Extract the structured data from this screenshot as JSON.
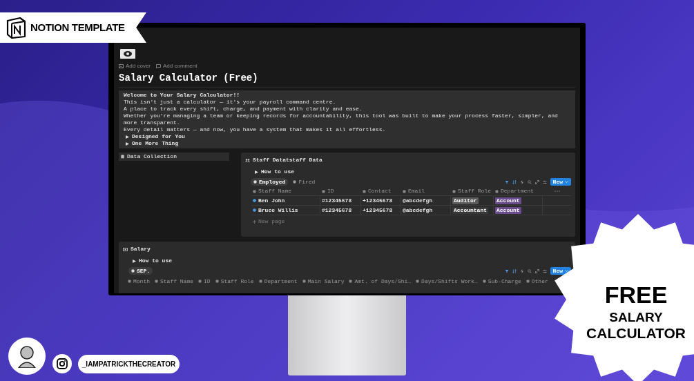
{
  "badge": {
    "label": "NOTION TEMPLATE"
  },
  "page": {
    "links": [
      "Add cover",
      "Add comment"
    ],
    "title": "Salary Calculator (Free)",
    "callout": {
      "lines": [
        "Welcome to Your Salary Calculator!!",
        "This isn't just a calculator — it's your payroll command centre.",
        "A place to track every shift, charge, and payment with clarity and ease.",
        "Whether you're managing a team or keeping records for accountability, this tool was built to make your process faster, simpler, and more transparent.",
        "Every detail matters — and now, you have a system that makes it all effortless."
      ],
      "toggles": [
        "Designed for You",
        "One More Thing"
      ]
    }
  },
  "sidebar": {
    "items": [
      {
        "label": "Data Collection",
        "selected": true
      }
    ]
  },
  "staff_db": {
    "title": "Staff Datatstaff Data",
    "toggle": "How to use",
    "views": [
      {
        "label": "Employed",
        "selected": true
      },
      {
        "label": "Fired",
        "selected": false
      }
    ],
    "new_button": "New",
    "columns": [
      "Staff Name",
      "ID",
      "Contact",
      "Email",
      "Staff Role",
      "Department"
    ],
    "rows": [
      {
        "name": "Ben John",
        "id": "#12345678",
        "contact": "+12345678",
        "email": "@abcdefgh",
        "role": {
          "label": "Auditor",
          "color": "#5a5a5a"
        },
        "department": {
          "label": "Account",
          "color": "#6a4c8c"
        }
      },
      {
        "name": "Bruce Willis",
        "id": "#12345678",
        "contact": "+12345678",
        "email": "@abcdefgh",
        "role": {
          "label": "Accountant",
          "color": "#383838"
        },
        "department": {
          "label": "Account",
          "color": "#6a4c8c"
        }
      }
    ],
    "add_row": "New page"
  },
  "salary_db": {
    "title": "Salary",
    "toggle": "How to use",
    "views": [
      {
        "label": "SEP.",
        "selected": true
      }
    ],
    "new_button": "New",
    "columns": [
      "Month",
      "Staff Name",
      "ID",
      "Staff Role",
      "Department",
      "Main Salary",
      "Amt. of Days/Shi…",
      "Days/Shifts Work…",
      "Sub-Charge",
      "Other"
    ]
  },
  "promo": {
    "lines": [
      "FREE",
      "SALARY",
      "CALCULATOR"
    ]
  },
  "social": {
    "handle": "_IAMPATRICKTHECREATOR"
  }
}
